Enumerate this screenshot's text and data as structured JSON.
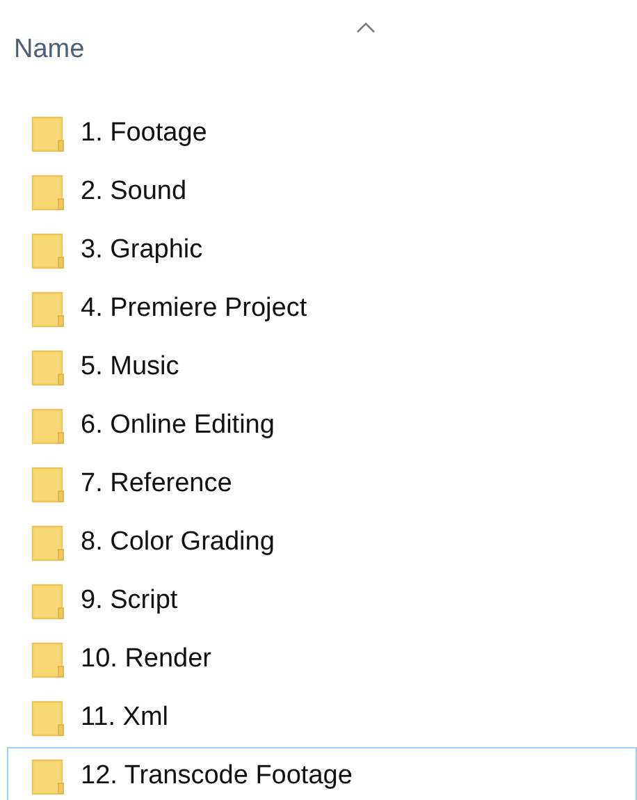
{
  "column_header": {
    "label": "Name",
    "sort_ascending": true
  },
  "folders": [
    {
      "name": "1. Footage",
      "selected": false
    },
    {
      "name": "2. Sound",
      "selected": false
    },
    {
      "name": "3. Graphic",
      "selected": false
    },
    {
      "name": "4. Premiere Project",
      "selected": false
    },
    {
      "name": "5. Music",
      "selected": false
    },
    {
      "name": "6. Online Editing",
      "selected": false
    },
    {
      "name": "7. Reference",
      "selected": false
    },
    {
      "name": "8. Color Grading",
      "selected": false
    },
    {
      "name": "9. Script",
      "selected": false
    },
    {
      "name": "10. Render",
      "selected": false
    },
    {
      "name": "11. Xml",
      "selected": false
    },
    {
      "name": "12. Transcode Footage",
      "selected": true
    }
  ]
}
